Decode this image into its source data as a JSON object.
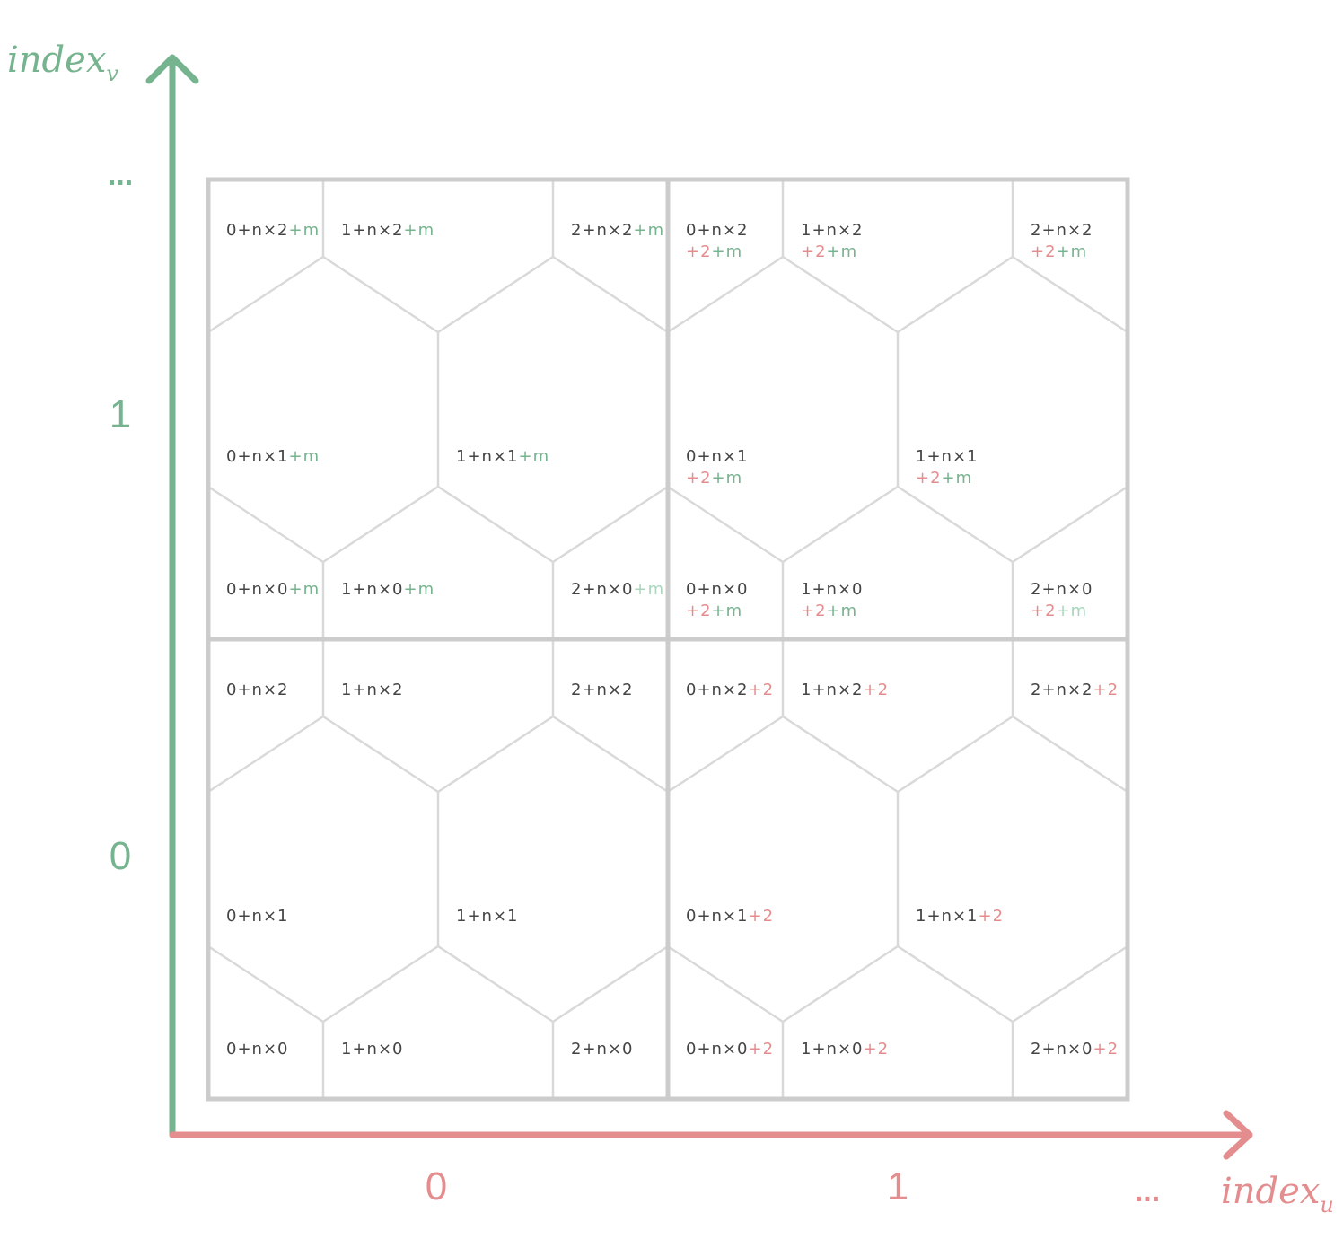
{
  "colors": {
    "green": "#76b38f",
    "green_light": "#a8d5bb",
    "red": "#e48d8e",
    "dark": "#444444",
    "frame": "#cccccc",
    "hexline": "#d9d9d9"
  },
  "axes": {
    "u": {
      "title": "index",
      "subscript": "u",
      "ticks": [
        "0",
        "1"
      ],
      "more": "..."
    },
    "v": {
      "title": "index",
      "subscript": "v",
      "ticks": [
        "0",
        "1"
      ],
      "more": "..."
    }
  },
  "tiles": {
    "u0v0": [
      {
        "base": "0+n×2",
        "extra": []
      },
      {
        "base": "1+n×2",
        "extra": []
      },
      {
        "base": "2+n×2",
        "extra": []
      },
      {
        "base": "0+n×1",
        "extra": []
      },
      {
        "base": "1+n×1",
        "extra": []
      },
      {
        "base": "0+n×0",
        "extra": []
      },
      {
        "base": "1+n×0",
        "extra": []
      },
      {
        "base": "2+n×0",
        "extra": []
      }
    ],
    "u1v0": [
      {
        "base": "0+n×2",
        "extra": [
          {
            "t": "+2",
            "c": "red"
          }
        ]
      },
      {
        "base": "1+n×2",
        "extra": [
          {
            "t": "+2",
            "c": "red"
          }
        ]
      },
      {
        "base": "2+n×2",
        "extra": [
          {
            "t": "+2",
            "c": "red"
          }
        ]
      },
      {
        "base": "0+n×1",
        "extra": [
          {
            "t": "+2",
            "c": "red"
          }
        ]
      },
      {
        "base": "1+n×1",
        "extra": [
          {
            "t": "+2",
            "c": "red"
          }
        ]
      },
      {
        "base": "0+n×0",
        "extra": [
          {
            "t": "+2",
            "c": "red"
          }
        ]
      },
      {
        "base": "1+n×0",
        "extra": [
          {
            "t": "+2",
            "c": "red"
          }
        ]
      },
      {
        "base": "2+n×0",
        "extra": [
          {
            "t": "+2",
            "c": "red"
          }
        ]
      }
    ],
    "u0v1": [
      {
        "base": "0+n×2",
        "extra": [
          {
            "t": "+m",
            "c": "green"
          }
        ]
      },
      {
        "base": "1+n×2",
        "extra": [
          {
            "t": "+m",
            "c": "green"
          }
        ]
      },
      {
        "base": "2+n×2",
        "extra": [
          {
            "t": "+m",
            "c": "green"
          }
        ]
      },
      {
        "base": "0+n×1",
        "extra": [
          {
            "t": "+m",
            "c": "green"
          }
        ]
      },
      {
        "base": "1+n×1",
        "extra": [
          {
            "t": "+m",
            "c": "green"
          }
        ]
      },
      {
        "base": "0+n×0",
        "extra": [
          {
            "t": "+m",
            "c": "green"
          }
        ]
      },
      {
        "base": "1+n×0",
        "extra": [
          {
            "t": "+m",
            "c": "green"
          }
        ]
      },
      {
        "base": "2+n×0",
        "extra": [
          {
            "t": "+m",
            "c": "green_light"
          }
        ]
      }
    ],
    "u1v1": [
      {
        "base": "0+n×2",
        "extra": [
          {
            "t": "+2",
            "c": "red"
          },
          {
            "t": "+m",
            "c": "green"
          }
        ]
      },
      {
        "base": "1+n×2",
        "extra": [
          {
            "t": "+2",
            "c": "red"
          },
          {
            "t": "+m",
            "c": "green"
          }
        ]
      },
      {
        "base": "2+n×2",
        "extra": [
          {
            "t": "+2",
            "c": "red"
          },
          {
            "t": "+m",
            "c": "green"
          }
        ]
      },
      {
        "base": "0+n×1",
        "extra": [
          {
            "t": "+2",
            "c": "red"
          },
          {
            "t": "+m",
            "c": "green"
          }
        ]
      },
      {
        "base": "1+n×1",
        "extra": [
          {
            "t": "+2",
            "c": "red"
          },
          {
            "t": "+m",
            "c": "green"
          }
        ]
      },
      {
        "base": "0+n×0",
        "extra": [
          {
            "t": "+2",
            "c": "red"
          },
          {
            "t": "+m",
            "c": "green"
          }
        ]
      },
      {
        "base": "1+n×0",
        "extra": [
          {
            "t": "+2",
            "c": "red"
          },
          {
            "t": "+m",
            "c": "green"
          }
        ]
      },
      {
        "base": "2+n×0",
        "extra": [
          {
            "t": "+2",
            "c": "red"
          },
          {
            "t": "+m",
            "c": "green_light"
          }
        ]
      }
    ]
  }
}
